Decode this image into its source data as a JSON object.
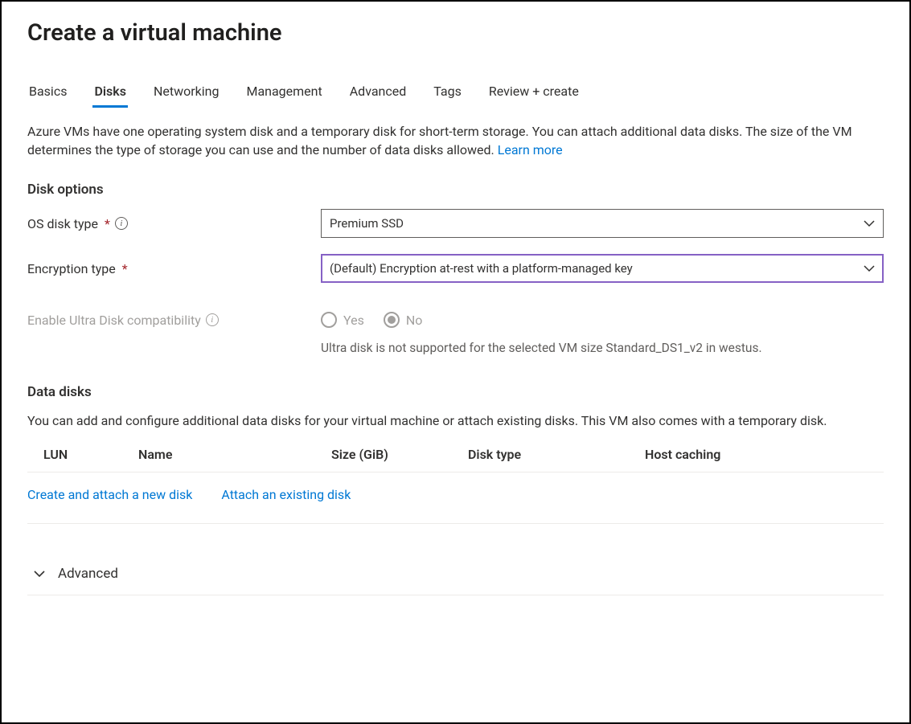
{
  "title": "Create a virtual machine",
  "tabs": [
    {
      "label": "Basics",
      "active": false
    },
    {
      "label": "Disks",
      "active": true
    },
    {
      "label": "Networking",
      "active": false
    },
    {
      "label": "Management",
      "active": false
    },
    {
      "label": "Advanced",
      "active": false
    },
    {
      "label": "Tags",
      "active": false
    },
    {
      "label": "Review + create",
      "active": false
    }
  ],
  "intro": {
    "text": "Azure VMs have one operating system disk and a temporary disk for short-term storage. You can attach additional data disks. The size of the VM determines the type of storage you can use and the number of data disks allowed.  ",
    "link": "Learn more"
  },
  "disk_options": {
    "heading": "Disk options",
    "os_disk_type": {
      "label": "OS disk type",
      "value": "Premium SSD"
    },
    "encryption_type": {
      "label": "Encryption type",
      "value": "(Default) Encryption at-rest with a platform-managed key"
    },
    "ultra_disk": {
      "label": "Enable Ultra Disk compatibility",
      "options": {
        "yes": "Yes",
        "no": "No"
      },
      "selected": "no",
      "hint": "Ultra disk is not supported for the selected VM size Standard_DS1_v2 in westus."
    }
  },
  "data_disks": {
    "heading": "Data disks",
    "description": "You can add and configure additional data disks for your virtual machine or attach existing disks. This VM also comes with a temporary disk.",
    "columns": [
      "LUN",
      "Name",
      "Size (GiB)",
      "Disk type",
      "Host caching"
    ],
    "actions": {
      "create": "Create and attach a new disk",
      "attach": "Attach an existing disk"
    }
  },
  "advanced": {
    "label": "Advanced"
  }
}
